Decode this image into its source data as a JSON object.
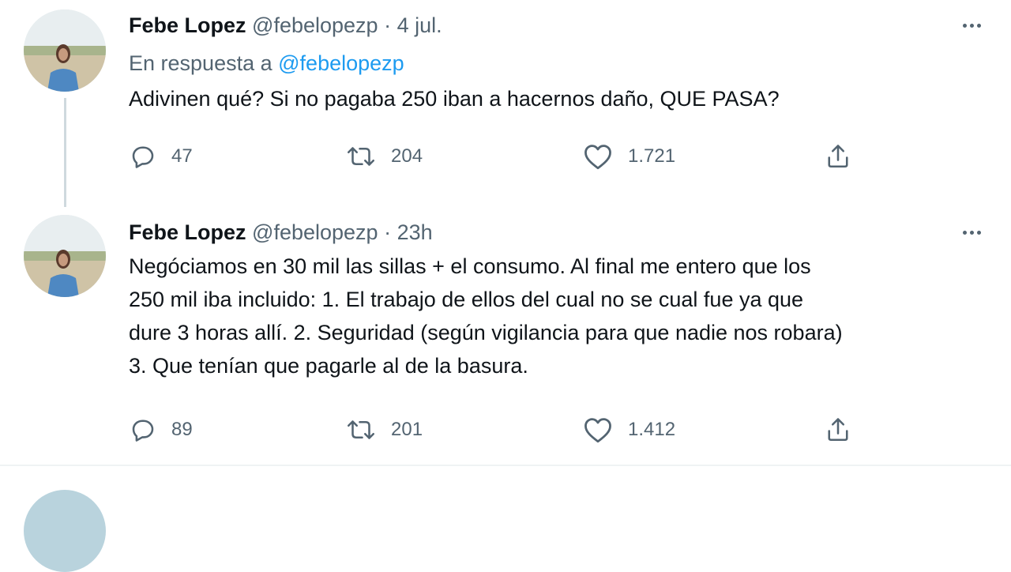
{
  "tweets": [
    {
      "name": "Febe Lopez",
      "handle": "@febelopezp",
      "separator": "·",
      "time": "4 jul.",
      "reply_prefix": "En respuesta a",
      "reply_mention": "@febelopezp",
      "text": "Adivinen qué? Si no pagaba 250 iban a hacernos daño, QUE PASA?",
      "replies": "47",
      "retweets": "204",
      "likes": "1.721"
    },
    {
      "name": "Febe Lopez",
      "handle": "@febelopezp",
      "separator": "·",
      "time": "23h",
      "text_lines": [
        "Negóciamos en 30 mil las sillas + el consumo. Al final me entero que los",
        "250 mil iba incluido: 1. El trabajo de ellos del cual no se cual fue ya que",
        "dure 3 horas allí. 2. Seguridad (según vigilancia para que nadie nos robara)",
        "3. Que tenían que pagarle al de la basura."
      ],
      "replies": "89",
      "retweets": "201",
      "likes": "1.412"
    }
  ],
  "icons": {
    "reply": "reply-icon",
    "retweet": "retweet-icon",
    "like": "heart-icon",
    "share": "share-icon",
    "more": "more-options-icon"
  },
  "colors": {
    "text": "#0f1419",
    "secondary": "#536471",
    "link": "#1d9bf0",
    "thread_line": "#cfd9de",
    "divider": "#eff3f4"
  }
}
